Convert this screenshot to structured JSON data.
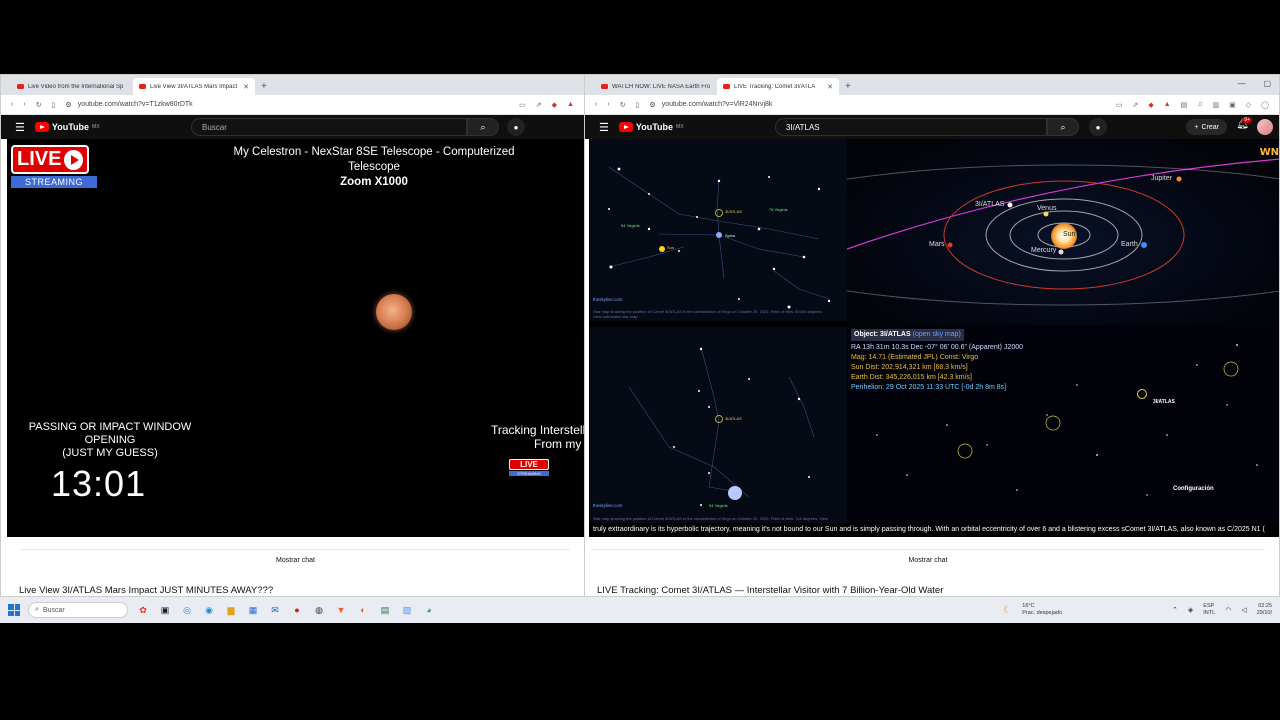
{
  "left_window": {
    "tabs": [
      {
        "title": "Live Video from the International Sp",
        "active": false
      },
      {
        "title": "Live View 3I/ATLAS Mars Impact",
        "active": true
      }
    ],
    "url": "youtube.com/watch?v=T1zkw80rDTk",
    "search_placeholder": "Buscar",
    "logo_text": "YouTube",
    "logo_region": "MX",
    "video": {
      "live_label": "LIVE",
      "streaming_label": "STREAMING",
      "scope_title": "My Celestron - NexStar 8SE Telescope - Computerized Telescope",
      "zoom": "Zoom X1000",
      "passing_line1": "PASSING OR IMPACT WINDOW",
      "passing_line2": "OPENING",
      "passing_line3": "(JUST MY GUESS)",
      "countdown": "13:01",
      "tracking_line1": "Tracking Interstell",
      "tracking_line2": "From my",
      "mini_live": "LIVE",
      "mini_streaming": "STREAMING"
    },
    "show_chat": "Mostrar chat",
    "video_title": "Live View 3I/ATLAS Mars Impact JUST MINUTES AWAY???"
  },
  "right_window": {
    "tabs": [
      {
        "title": "WATCH NOW: LIVE NASA Earth Fro",
        "active": false
      },
      {
        "title": "LIVE Tracking: Comet 3I/ATLA",
        "active": true
      }
    ],
    "url": "youtube.com/watch?v=VlR24Nrvj8k",
    "search_value": "3I/ATLAS",
    "logo_text": "YouTube",
    "logo_region": "MX",
    "create_label": "Crear",
    "notif_badge": "9+",
    "video": {
      "chart_site": "theskylive.com",
      "chart_caption_top": "Star map showing the position of Comet 3I/ATLAS in the constellation of Virgo on October 29, 2025. Field of view: 50x30 degrees.",
      "chart_caption_top2": "View interactive star map",
      "chart_caption_bot": "Star map showing the position of Comet 3I/ATLAS in the constellation of Virgo on October 29, 2025. Field of view: 7x4 degrees. View",
      "chart_labels_top": [
        "3I/ATLAS",
        "Sun",
        "76 Virginis",
        "54 Virginis",
        "Spica"
      ],
      "chart_labels_bot": [
        "3I/ATLAS",
        "94 Virginis"
      ],
      "orbit_labels": {
        "atlas": "3I/ATLAS",
        "venus": "Venus",
        "jupiter": "Jupiter",
        "mars": "Mars",
        "mercury": "Mercury",
        "earth": "Earth",
        "sun": "Sun"
      },
      "wn_logo": "WN",
      "object_header": "Object: 3I/ATLAS",
      "object_link": "(open sky map)",
      "ra_line": "RA 13h 31m 10.3s Dec -07° 06' 00.6\" (Apparent) J2000",
      "mag_line": "Mag: 14.71 (Estimated JPL)  Const: Virgo",
      "sun_dist": "Sun Dist: 202,914,321 km [68.3 km/s]",
      "earth_dist": "Earth Dist: 345,226,015 km [42.3 km/s]",
      "perihelion": "Perihelion: 29 Oct 2025 11:33 UTC [-0d 2h 8m 8s]",
      "sky_atlas_label": "3I/ATLAS",
      "config_label": "Configuración",
      "subtitle": "truly extraordinary is its hyperbolic trajectory, meaning it's not bound to our Sun and is simply passing through. With an orbital eccentricity of over 6 and a blistering excess sComet 3I/ATLAS, also known as C/2025 N1 ("
    },
    "show_chat": "Mostrar chat",
    "video_title": "LIVE Tracking: Comet 3I/ATLAS — Interstellar Visitor with 7 Billion-Year-Old Water"
  },
  "taskbar": {
    "search_placeholder": "Buscar",
    "weather_temp": "16°C",
    "weather_desc": "Prac. despejado",
    "lang1": "ESP",
    "lang2": "INTL",
    "time": "02:25",
    "date": "29/10/"
  },
  "colors": {
    "yt_red": "#ff0000",
    "live_red": "#e10000",
    "streaming_blue": "#3c6bd6",
    "atlas_magenta": "#d63bd6"
  }
}
